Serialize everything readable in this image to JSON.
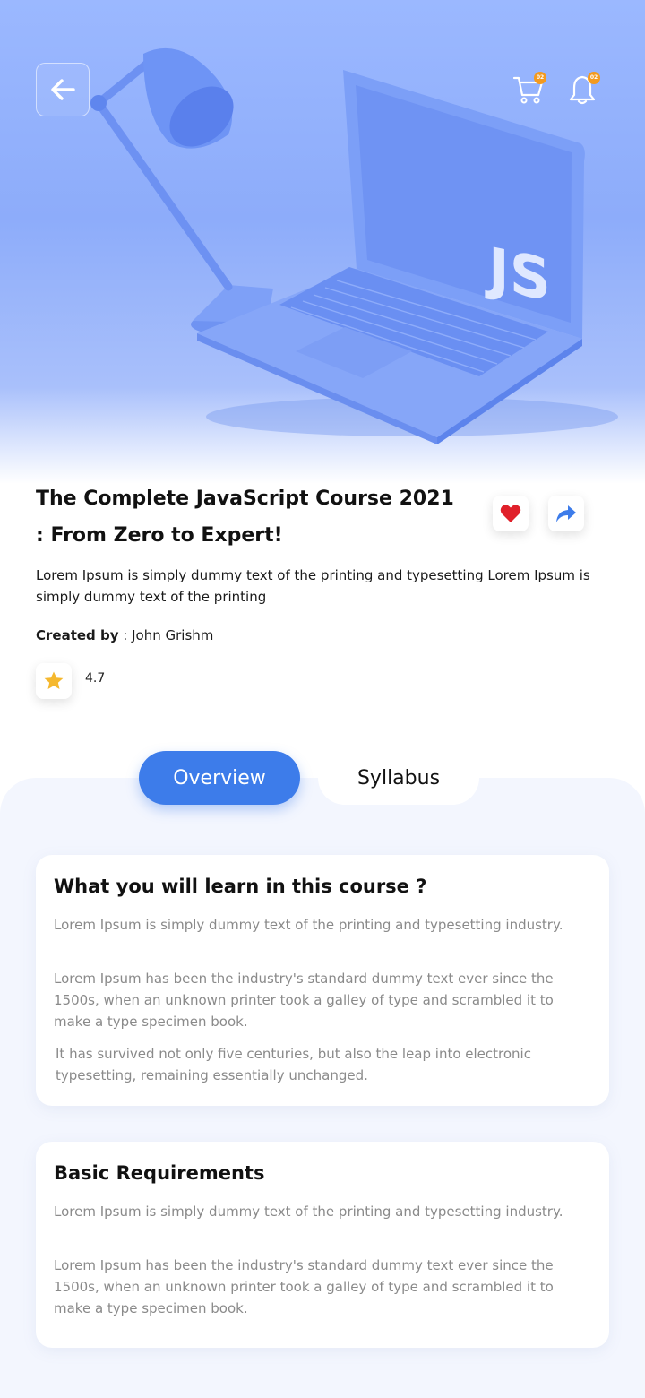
{
  "header": {
    "back_label": "Back",
    "cart_badge": "02",
    "notification_badge": "02",
    "hero_logo_text": "JS"
  },
  "course": {
    "title": "The Complete JavaScript Course 2021 : From Zero to Expert!",
    "description": "Lorem Ipsum is simply dummy text of the printing and typesetting Lorem Ipsum is simply dummy text of the printing",
    "created_by_label": "Created by",
    "created_by_separator": " : ",
    "author": "John Grishm",
    "rating": "4.7"
  },
  "tabs": [
    {
      "label": "Overview",
      "active": true
    },
    {
      "label": "Syllabus",
      "active": false
    }
  ],
  "learn": {
    "title": "What you will learn in this course ?",
    "paragraphs": [
      "Lorem Ipsum is simply dummy text of the printing and typesetting industry.",
      "Lorem Ipsum has been the industry's standard dummy text ever since the 1500s, when an unknown printer took a galley of type and scrambled it to make a type specimen book.",
      "It has survived not only five centuries, but also the leap into electronic typesetting, remaining essentially unchanged."
    ]
  },
  "requirements": {
    "title": "Basic Requirements",
    "paragraphs": [
      "Lorem Ipsum is simply dummy text of the printing and typesetting industry.",
      "Lorem Ipsum has been the industry's standard dummy text ever since the 1500s, when an unknown printer took a galley of type and scrambled it to make a type specimen book."
    ]
  },
  "colors": {
    "accent": "#3d7cea",
    "hero_blue": "#8dacfa",
    "badge": "#f39a1f",
    "heart": "#e0202a",
    "star": "#f5b82e",
    "panel_bg": "#f3f6fe"
  },
  "icons": {
    "back": "arrow-left-icon",
    "cart": "cart-icon",
    "bell": "bell-icon",
    "favorite": "heart-icon",
    "share": "share-arrow-icon",
    "rating": "star-icon"
  }
}
